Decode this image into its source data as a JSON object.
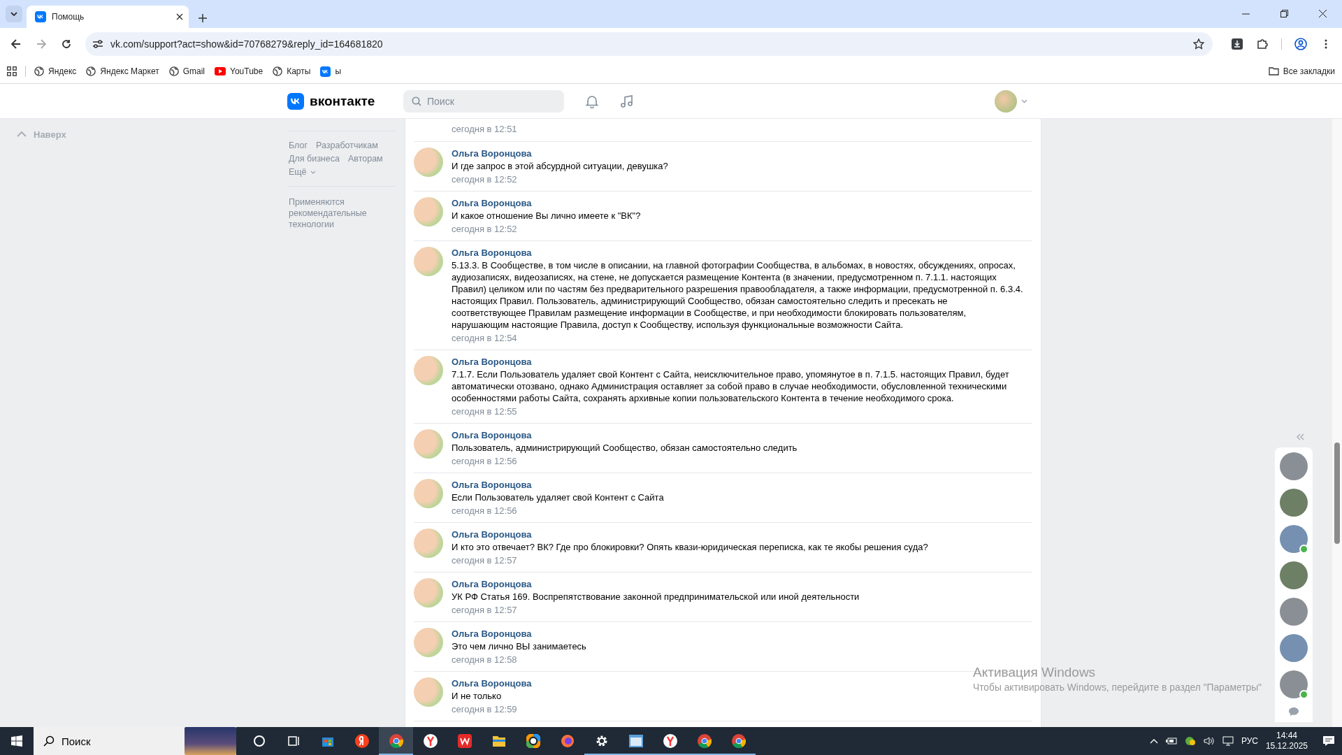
{
  "browser": {
    "tab_title": "Помощь",
    "url": "vk.com/support?act=show&id=70768279&reply_id=164681820",
    "bookmarks": [
      {
        "kind": "globe",
        "label": "Яндекс"
      },
      {
        "kind": "globe",
        "label": "Яндекс Маркет"
      },
      {
        "kind": "globe",
        "label": "Gmail"
      },
      {
        "kind": "youtube",
        "label": "YouTube"
      },
      {
        "kind": "globe",
        "label": "Карты"
      },
      {
        "kind": "vk",
        "label": "ы"
      }
    ],
    "all_bookmarks": "Все закладки"
  },
  "vk_header": {
    "logo": "вконтакте",
    "search_placeholder": "Поиск"
  },
  "sidebar": {
    "back_to_top": "Наверх",
    "links": [
      "Блог",
      "Разработчикам",
      "Для бизнеса",
      "Авторам"
    ],
    "more": "Ещё",
    "note": "Применяются рекомендательные технологии"
  },
  "messages": [
    {
      "kind": "partial",
      "time": "сегодня в 12:51"
    },
    {
      "kind": "full",
      "author": "Ольга Воронцова",
      "text": "И где запрос в этой абсурдной ситуации, девушка?",
      "time": "сегодня в 12:52"
    },
    {
      "kind": "full",
      "author": "Ольга Воронцова",
      "text": "И какое отношение Вы лично имеете к \"ВК\"?",
      "time": "сегодня в 12:52"
    },
    {
      "kind": "full",
      "author": "Ольга Воронцова",
      "text": "5.13.3. В Сообществе, в том числе в описании, на главной фотографии Сообщества, в альбомах, в новостях, обсуждениях, опросах, аудиозаписях, видеозаписях, на стене, не допускается размещение Контента (в значении, предусмотренном п. 7.1.1. настоящих Правил) целиком или по частям без предварительного разрешения правообладателя, а также информации, предусмотренной п. 6.3.4. настоящих Правил. Пользователь, администрирующий Сообщество, обязан самостоятельно следить и пресекать не соответствующее Правилам размещение информации в Сообществе, и при необходимости блокировать пользователям, нарушающим настоящие Правила, доступ к Сообществу, используя функциональные возможности Сайта.",
      "time": "сегодня в 12:54"
    },
    {
      "kind": "full",
      "author": "Ольга Воронцова",
      "text": "7.1.7. Если Пользователь удаляет свой Контент с Сайта, неисключительное право, упомянутое в п. 7.1.5. настоящих Правил, будет автоматически отозвано, однако Администрация оставляет за собой право в случае необходимости, обусловленной техническими особенностями работы Сайта, сохранять архивные копии пользовательского Контента в течение необходимого срока.",
      "time": "сегодня в 12:55"
    },
    {
      "kind": "full",
      "author": "Ольга Воронцова",
      "text": "Пользователь, администрирующий Сообщество, обязан самостоятельно следить",
      "time": "сегодня в 12:56"
    },
    {
      "kind": "full",
      "author": "Ольга Воронцова",
      "text": "Если Пользователь удаляет свой Контент с Сайта",
      "time": "сегодня в 12:56"
    },
    {
      "kind": "full",
      "author": "Ольга Воронцова",
      "text": "И кто это отвечает? ВК? Где про блокировки? Опять квази-юридическая переписка, как те якобы решения суда?",
      "time": "сегодня в 12:57"
    },
    {
      "kind": "full",
      "author": "Ольга Воронцова",
      "text": "УК РФ Статья 169. Воспрепятствование законной предпринимательской или иной деятельности",
      "time": "сегодня в 12:57"
    },
    {
      "kind": "full",
      "author": "Ольга Воронцова",
      "text": "Это чем лично ВЫ занимаетесь",
      "time": "сегодня в 12:58"
    },
    {
      "kind": "full",
      "author": "Ольга Воронцова",
      "text": "И не только",
      "time": "сегодня в 12:59"
    }
  ],
  "friends": [
    {
      "online": false
    },
    {
      "online": false
    },
    {
      "online": true
    },
    {
      "online": false
    },
    {
      "online": false
    },
    {
      "online": false
    },
    {
      "online": true
    }
  ],
  "watermark": {
    "title": "Активация Windows",
    "text": "Чтобы активировать Windows, перейдите в раздел \"Параметры\""
  },
  "taskbar": {
    "search_placeholder": "Поиск",
    "apps": [
      {
        "kind": "cortana",
        "selected": false,
        "running": false
      },
      {
        "kind": "taskview",
        "selected": false,
        "running": false
      },
      {
        "kind": "store",
        "selected": false,
        "running": false
      },
      {
        "kind": "yandex",
        "selected": false,
        "running": false
      },
      {
        "kind": "chrome",
        "selected": true,
        "running": true
      },
      {
        "kind": "ybrowser",
        "selected": false,
        "running": false
      },
      {
        "kind": "wps",
        "selected": false,
        "running": false
      },
      {
        "kind": "explorer",
        "selected": false,
        "running": false
      },
      {
        "kind": "wheel",
        "selected": false,
        "running": false
      },
      {
        "kind": "firefox",
        "selected": false,
        "running": false
      },
      {
        "kind": "settings",
        "selected": false,
        "running": true
      },
      {
        "kind": "app",
        "selected": false,
        "running": true
      },
      {
        "kind": "ybrowser",
        "selected": false,
        "running": true
      },
      {
        "kind": "chrome",
        "selected": false,
        "running": true
      },
      {
        "kind": "chrome",
        "selected": false,
        "running": true
      }
    ],
    "language": "РУС",
    "time": "14:44",
    "date": "15.12.2025"
  }
}
